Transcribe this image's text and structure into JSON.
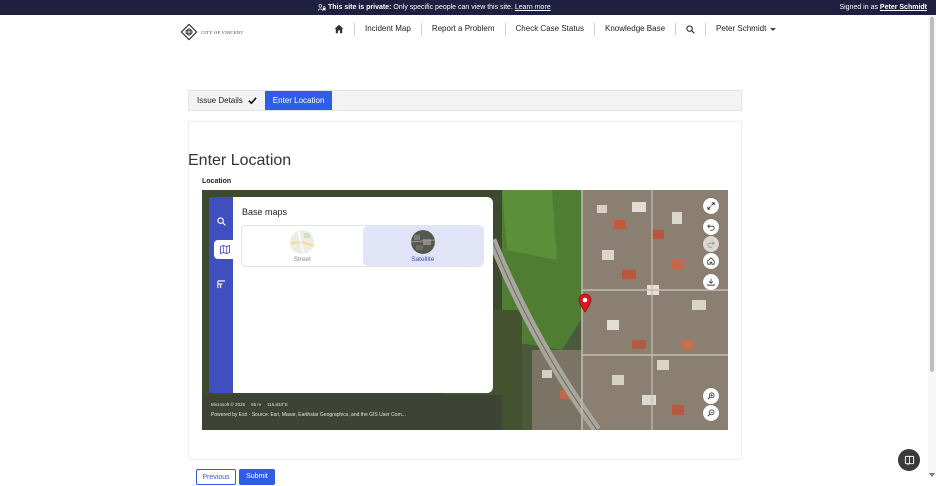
{
  "private_bar": {
    "bold_text": "This site is private:",
    "text": "Only specific people can view this site.",
    "link": "Learn more",
    "signed_in_prefix": "Signed in as",
    "signed_in_user": "Peter Schmidt"
  },
  "header": {
    "logo_text": "CITY OF VINCENT",
    "nav": [
      "Incident Map",
      "Report a Problem",
      "Check Case Status",
      "Knowledge Base"
    ],
    "user_menu": "Peter Schmidt"
  },
  "tabs": [
    {
      "label": "Issue Details",
      "completed": true
    },
    {
      "label": "Enter Location",
      "active": true
    }
  ],
  "page": {
    "title": "Enter Location",
    "field_label": "Location"
  },
  "map": {
    "basemaps_title": "Base maps",
    "basemaps": [
      {
        "label": "Street",
        "selected": false
      },
      {
        "label": "Satellite",
        "selected": true
      }
    ],
    "attribution_scale": [
      "Microsoft © 2025",
      "55 m",
      "115.833°E"
    ],
    "attribution_powered": "Powered by Esri · Source: Esri, Maxar, Earthstar Geographics, and the GIS User Com...",
    "colors": {
      "accent": "#3f4fc0",
      "marker": "#d71920"
    }
  },
  "buttons": {
    "previous": "Previous",
    "submit": "Submit"
  },
  "colors": {
    "primary": "#2f5de8",
    "top_bar": "#1f1f3f"
  }
}
